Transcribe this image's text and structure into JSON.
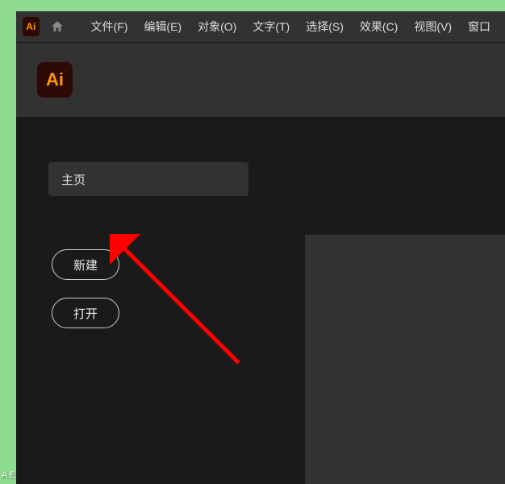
{
  "app": {
    "icon_text": "Ai",
    "logo_text": "Ai"
  },
  "menu": {
    "items": [
      "文件(F)",
      "编辑(E)",
      "对象(O)",
      "文字(T)",
      "选择(S)",
      "效果(C)",
      "视图(V)",
      "窗口"
    ]
  },
  "home": {
    "button_label": "主页"
  },
  "actions": {
    "new_label": "新建",
    "open_label": "打开"
  },
  "desktop": {
    "icon_label": "A\nE"
  }
}
